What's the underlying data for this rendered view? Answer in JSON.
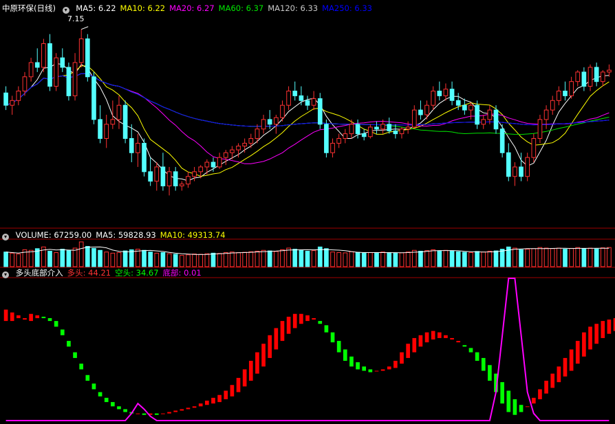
{
  "colors": {
    "up": "#ff3232",
    "down": "#54ffff",
    "ma5": "#ffffff",
    "ma10": "#ffff00",
    "ma20": "#ff00ff",
    "ma60": "#00e600",
    "ma120": "#c8c8c8",
    "ma250": "#0000ff",
    "ind_up": "#ff0000",
    "ind_down": "#00ff00",
    "bottom": "#ff00ff",
    "divider": "#a00000"
  },
  "price_panel": {
    "title": "中原环保(日线)",
    "ma_labels": [
      {
        "text": "MA5: 6.22",
        "color": "#ffffff"
      },
      {
        "text": "MA10: 6.22",
        "color": "#ffff00"
      },
      {
        "text": "MA20: 6.27",
        "color": "#ff00ff"
      },
      {
        "text": "MA60: 6.37",
        "color": "#00e600"
      },
      {
        "text": "MA120: 6.33",
        "color": "#c8c8c8"
      },
      {
        "text": "MA250: 6.33",
        "color": "#0000ff"
      }
    ],
    "high_annotation": "7.15"
  },
  "volume_panel": {
    "labels": [
      {
        "text": "VOLUME: 67259.00",
        "color": "#ffffff"
      },
      {
        "text": "MA5: 59828.93",
        "color": "#ffffff"
      },
      {
        "text": "MA10: 49313.74",
        "color": "#ffff00"
      }
    ]
  },
  "indicator_panel": {
    "labels": [
      {
        "text": "多头底部介入",
        "color": "#ffffff"
      },
      {
        "text": "多头: 44.21",
        "color": "#ff3232"
      },
      {
        "text": "空头: 34.67",
        "color": "#00ff00"
      },
      {
        "text": "底部: 0.01",
        "color": "#ff00ff"
      }
    ]
  },
  "chart_data": [
    {
      "type": "candlestick",
      "title": "中原环保(日线)",
      "ylim": [
        5.2,
        7.3
      ],
      "annotation": {
        "text": "7.15",
        "price": 7.15
      },
      "ohlc": [
        [
          6.48,
          6.55,
          6.3,
          6.35
        ],
        [
          6.35,
          6.45,
          6.25,
          6.4
        ],
        [
          6.4,
          6.55,
          6.35,
          6.5
        ],
        [
          6.5,
          6.7,
          6.45,
          6.65
        ],
        [
          6.65,
          6.85,
          6.6,
          6.8
        ],
        [
          6.8,
          6.95,
          6.7,
          6.75
        ],
        [
          6.75,
          7.05,
          6.7,
          7.0
        ],
        [
          7.0,
          7.1,
          6.5,
          6.55
        ],
        [
          6.55,
          6.9,
          6.5,
          6.85
        ],
        [
          6.85,
          6.95,
          6.7,
          6.75
        ],
        [
          6.75,
          6.8,
          6.4,
          6.45
        ],
        [
          6.45,
          6.9,
          6.4,
          6.8
        ],
        [
          6.8,
          7.15,
          6.75,
          7.05
        ],
        [
          7.05,
          7.1,
          6.6,
          6.65
        ],
        [
          6.65,
          6.7,
          6.15,
          6.2
        ],
        [
          6.2,
          6.35,
          5.95,
          6.0
        ],
        [
          6.0,
          6.25,
          5.9,
          6.15
        ],
        [
          6.15,
          6.4,
          6.1,
          6.2
        ],
        [
          6.2,
          6.45,
          6.1,
          6.35
        ],
        [
          6.35,
          6.4,
          5.95,
          6.0
        ],
        [
          6.0,
          6.15,
          5.75,
          5.85
        ],
        [
          5.85,
          6.05,
          5.7,
          5.95
        ],
        [
          5.95,
          6.0,
          5.6,
          5.65
        ],
        [
          5.65,
          5.8,
          5.5,
          5.55
        ],
        [
          5.55,
          5.75,
          5.45,
          5.7
        ],
        [
          5.7,
          5.85,
          5.45,
          5.5
        ],
        [
          5.5,
          5.7,
          5.4,
          5.65
        ],
        [
          5.65,
          5.7,
          5.45,
          5.5
        ],
        [
          5.5,
          5.55,
          5.45,
          5.52
        ],
        [
          5.52,
          5.65,
          5.48,
          5.6
        ],
        [
          5.6,
          5.7,
          5.55,
          5.65
        ],
        [
          5.65,
          5.72,
          5.58,
          5.7
        ],
        [
          5.7,
          5.78,
          5.62,
          5.75
        ],
        [
          5.75,
          5.8,
          5.65,
          5.7
        ],
        [
          5.7,
          5.85,
          5.68,
          5.8
        ],
        [
          5.8,
          5.88,
          5.72,
          5.85
        ],
        [
          5.85,
          5.92,
          5.78,
          5.88
        ],
        [
          5.88,
          5.95,
          5.8,
          5.92
        ],
        [
          5.92,
          6.0,
          5.85,
          5.95
        ],
        [
          5.95,
          6.05,
          5.9,
          6.0
        ],
        [
          6.0,
          6.15,
          5.95,
          6.1
        ],
        [
          6.1,
          6.25,
          6.05,
          6.2
        ],
        [
          6.2,
          6.3,
          6.1,
          6.15
        ],
        [
          6.15,
          6.25,
          6.05,
          6.22
        ],
        [
          6.22,
          6.4,
          6.18,
          6.35
        ],
        [
          6.35,
          6.55,
          6.3,
          6.5
        ],
        [
          6.5,
          6.6,
          6.4,
          6.45
        ],
        [
          6.45,
          6.55,
          6.35,
          6.4
        ],
        [
          6.4,
          6.45,
          6.3,
          6.35
        ],
        [
          6.35,
          6.5,
          6.3,
          6.42
        ],
        [
          6.42,
          6.48,
          6.1,
          6.15
        ],
        [
          6.15,
          6.2,
          5.8,
          5.85
        ],
        [
          5.85,
          6.0,
          5.8,
          5.95
        ],
        [
          5.95,
          6.05,
          5.9,
          6.0
        ],
        [
          6.0,
          6.1,
          5.95,
          6.05
        ],
        [
          6.05,
          6.2,
          6.0,
          6.15
        ],
        [
          6.15,
          6.2,
          6.0,
          6.05
        ],
        [
          6.05,
          6.1,
          5.98,
          6.02
        ],
        [
          6.02,
          6.15,
          6.0,
          6.12
        ],
        [
          6.12,
          6.18,
          6.05,
          6.1
        ],
        [
          6.1,
          6.2,
          6.05,
          6.15
        ],
        [
          6.15,
          6.22,
          6.05,
          6.08
        ],
        [
          6.08,
          6.15,
          6.0,
          6.05
        ],
        [
          6.05,
          6.12,
          6.0,
          6.1
        ],
        [
          6.1,
          6.18,
          6.05,
          6.12
        ],
        [
          6.12,
          6.35,
          6.1,
          6.3
        ],
        [
          6.3,
          6.4,
          6.2,
          6.25
        ],
        [
          6.25,
          6.4,
          6.2,
          6.35
        ],
        [
          6.35,
          6.55,
          6.3,
          6.5
        ],
        [
          6.5,
          6.6,
          6.4,
          6.45
        ],
        [
          6.45,
          6.58,
          6.4,
          6.52
        ],
        [
          6.52,
          6.6,
          6.35,
          6.4
        ],
        [
          6.4,
          6.48,
          6.3,
          6.35
        ],
        [
          6.35,
          6.42,
          6.25,
          6.3
        ],
        [
          6.3,
          6.38,
          6.2,
          6.35
        ],
        [
          6.35,
          6.4,
          6.1,
          6.15
        ],
        [
          6.15,
          6.25,
          6.1,
          6.2
        ],
        [
          6.2,
          6.35,
          6.15,
          6.3
        ],
        [
          6.3,
          6.35,
          6.05,
          6.1
        ],
        [
          6.1,
          6.15,
          5.8,
          5.85
        ],
        [
          5.85,
          5.95,
          5.55,
          5.6
        ],
        [
          5.6,
          5.75,
          5.5,
          5.7
        ],
        [
          5.7,
          5.85,
          5.55,
          5.6
        ],
        [
          5.6,
          5.85,
          5.55,
          5.8
        ],
        [
          5.8,
          6.05,
          5.75,
          6.0
        ],
        [
          6.0,
          6.25,
          5.95,
          6.2
        ],
        [
          6.2,
          6.35,
          6.1,
          6.3
        ],
        [
          6.3,
          6.45,
          6.25,
          6.4
        ],
        [
          6.4,
          6.55,
          6.35,
          6.5
        ],
        [
          6.5,
          6.6,
          6.4,
          6.45
        ],
        [
          6.45,
          6.65,
          6.42,
          6.6
        ],
        [
          6.6,
          6.72,
          6.55,
          6.7
        ],
        [
          6.7,
          6.75,
          6.5,
          6.55
        ],
        [
          6.55,
          6.78,
          6.5,
          6.75
        ],
        [
          6.75,
          6.8,
          6.55,
          6.6
        ],
        [
          6.6,
          6.72,
          6.55,
          6.7
        ],
        [
          6.7,
          6.78,
          6.65,
          6.72
        ]
      ]
    },
    {
      "type": "bar",
      "title": "VOLUME",
      "series": [
        {
          "name": "VOLUME",
          "values": [
            52,
            48,
            45,
            60,
            58,
            64,
            70,
            55,
            50,
            62,
            57,
            66,
            88,
            72,
            65,
            58,
            52,
            48,
            50,
            56,
            60,
            62,
            58,
            52,
            48,
            50,
            46,
            44,
            40,
            42,
            45,
            44,
            46,
            48,
            47,
            50,
            52,
            50,
            51,
            53,
            55,
            58,
            56,
            54,
            60,
            66,
            62,
            58,
            55,
            57,
            70,
            64,
            52,
            50,
            49,
            53,
            51,
            48,
            50,
            49,
            52,
            50,
            48,
            49,
            52,
            58,
            55,
            57,
            60,
            56,
            58,
            55,
            53,
            51,
            50,
            54,
            52,
            55,
            56,
            62,
            70,
            66,
            60,
            62,
            64,
            68,
            66,
            64,
            66,
            62,
            65,
            68,
            64,
            66,
            63,
            67,
            68
          ]
        }
      ]
    },
    {
      "type": "bar",
      "title": "多头底部介入",
      "series": [
        {
          "name": "多头",
          "values": [
            78,
            76,
            74,
            72,
            75,
            74,
            72,
            70,
            66,
            60,
            52,
            44,
            36,
            28,
            22,
            17,
            13,
            10,
            8,
            6,
            5,
            5,
            4,
            5,
            4,
            5,
            6,
            7,
            8,
            9,
            10,
            12,
            14,
            16,
            18,
            21,
            25,
            30,
            36,
            42,
            48,
            54,
            60,
            65,
            70,
            73,
            75,
            75,
            74,
            72,
            68,
            62,
            55,
            48,
            42,
            38,
            36,
            35,
            34,
            35,
            36,
            38,
            42,
            48,
            54,
            58,
            60,
            62,
            63,
            62,
            60,
            58,
            56,
            52,
            48,
            42,
            35,
            28,
            20,
            12,
            6,
            4,
            6,
            10,
            16,
            22,
            28,
            33,
            38,
            44,
            50,
            56,
            62,
            66,
            68,
            70,
            71,
            72
          ]
        },
        {
          "name": "空头",
          "values": [
            70,
            70,
            72,
            71,
            70,
            72,
            73,
            72,
            70,
            64,
            56,
            48,
            40,
            32,
            26,
            20,
            16,
            13,
            10,
            8,
            6,
            5,
            5,
            4,
            5,
            5,
            5,
            6,
            7,
            8,
            9,
            10,
            11,
            12,
            13,
            15,
            17,
            20,
            24,
            28,
            33,
            38,
            44,
            50,
            56,
            61,
            65,
            68,
            70,
            71,
            70,
            67,
            62,
            56,
            50,
            45,
            41,
            38,
            36,
            35,
            35,
            36,
            37,
            40,
            44,
            48,
            52,
            55,
            57,
            58,
            58,
            57,
            55,
            53,
            51,
            48,
            44,
            39,
            33,
            27,
            21,
            15,
            11,
            10,
            12,
            15,
            19,
            23,
            27,
            31,
            35,
            40,
            45,
            50,
            54,
            58,
            61,
            63
          ]
        },
        {
          "name": "底部",
          "values": [
            0,
            0,
            0,
            0,
            0,
            0,
            0,
            0,
            0,
            0,
            0,
            0,
            0,
            0,
            0,
            0,
            0,
            0,
            0,
            0,
            5,
            12,
            8,
            3,
            0,
            0,
            0,
            0,
            0,
            0,
            0,
            0,
            0,
            0,
            0,
            0,
            0,
            0,
            0,
            0,
            0,
            0,
            0,
            0,
            0,
            0,
            0,
            0,
            0,
            0,
            0,
            0,
            0,
            0,
            0,
            0,
            0,
            0,
            0,
            0,
            0,
            0,
            0,
            0,
            0,
            0,
            0,
            0,
            0,
            0,
            0,
            0,
            0,
            0,
            0,
            0,
            0,
            0,
            20,
            60,
            100,
            100,
            60,
            20,
            5,
            0,
            0,
            0,
            0,
            0,
            0,
            0,
            0,
            0,
            0,
            0,
            0
          ]
        }
      ],
      "ylim": [
        0,
        100
      ]
    }
  ]
}
